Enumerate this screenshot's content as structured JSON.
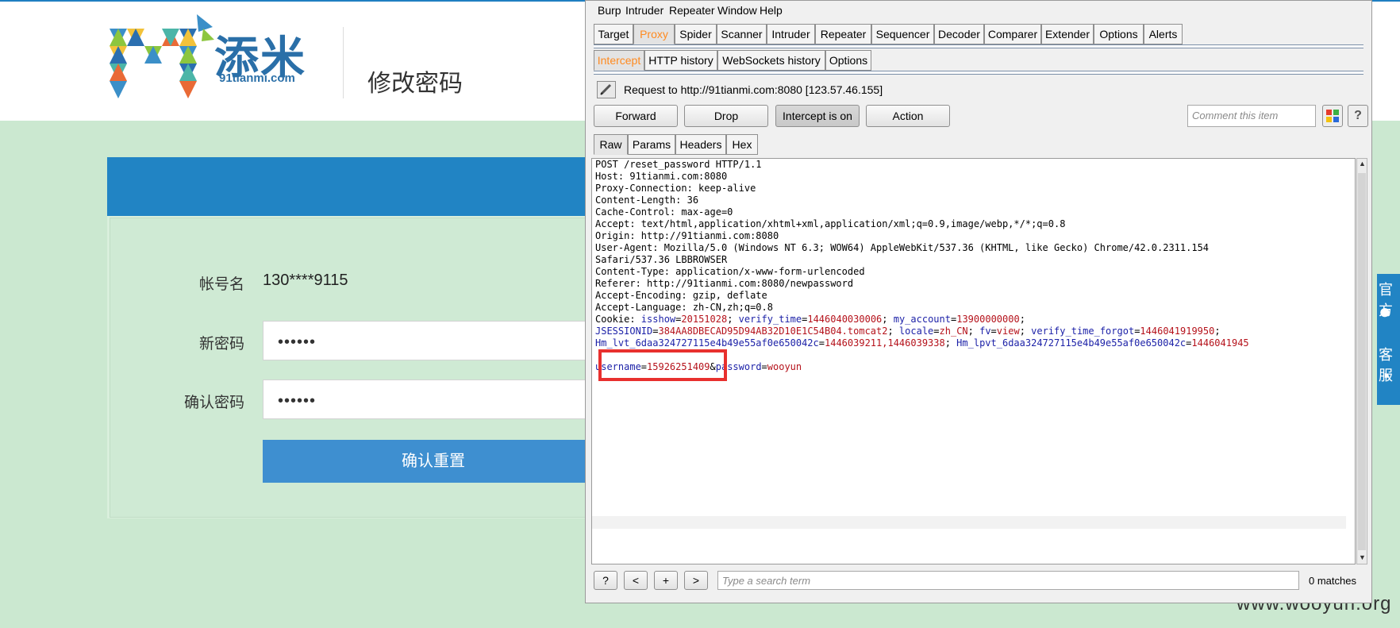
{
  "site": {
    "logo_cn": "添米",
    "logo_sub": "91tianmi.com",
    "page_title": "修改密码",
    "form": {
      "account_label": "帐号名",
      "account_value": "130****9115",
      "new_pwd_label": "新密码",
      "new_pwd_value": "••••••",
      "confirm_pwd_label": "确认密码",
      "confirm_pwd_value": "••••••",
      "submit_label": "确认重置"
    },
    "side_float": {
      "line1": "官方",
      "line2": "客服"
    },
    "watermark": "www.wooyun.org"
  },
  "burp": {
    "menu": [
      "Burp",
      "Intruder",
      "Repeater",
      "Window",
      "Help"
    ],
    "main_tabs": [
      "Target",
      "Proxy",
      "Spider",
      "Scanner",
      "Intruder",
      "Repeater",
      "Sequencer",
      "Decoder",
      "Comparer",
      "Extender",
      "Options",
      "Alerts"
    ],
    "main_active": "Proxy",
    "proxy_tabs": [
      "Intercept",
      "HTTP history",
      "WebSockets history",
      "Options"
    ],
    "proxy_active": "Intercept",
    "request_line": "Request to http://91tianmi.com:8080  [123.57.46.155]",
    "buttons": {
      "forward": "Forward",
      "drop": "Drop",
      "intercept": "Intercept is on",
      "action": "Action"
    },
    "comment_placeholder": "Comment this item",
    "help_label": "?",
    "view_tabs": [
      "Raw",
      "Params",
      "Headers",
      "Hex"
    ],
    "view_active": "Raw",
    "request_lines": [
      "POST /reset_password HTTP/1.1",
      "Host: 91tianmi.com:8080",
      "Proxy-Connection: keep-alive",
      "Content-Length: 36",
      "Cache-Control: max-age=0",
      "Accept: text/html,application/xhtml+xml,application/xml;q=0.9,image/webp,*/*;q=0.8",
      "Origin: http://91tianmi.com:8080",
      "User-Agent: Mozilla/5.0 (Windows NT 6.3; WOW64) AppleWebKit/537.36 (KHTML, like Gecko) Chrome/42.0.2311.154",
      "Safari/537.36 LBBROWSER",
      "Content-Type: application/x-www-form-urlencoded",
      "Referer: http://91tianmi.com:8080/newpassword",
      "Accept-Encoding: gzip, deflate",
      "Accept-Language: zh-CN,zh;q=0.8"
    ],
    "cookie_prefix": "Cookie: ",
    "cookie_lines": [
      [
        [
          "isshow",
          "20151028"
        ],
        [
          "verify_time",
          "1446040030006"
        ],
        [
          "my_account",
          "13900000000"
        ]
      ],
      [
        [
          "JSESSIONID",
          "384AA8DBECAD95D94AB32D10E1C54B04.tomcat2"
        ],
        [
          "locale",
          "zh_CN"
        ],
        [
          "fv",
          "view"
        ],
        [
          "verify_time_forgot",
          "1446041919950"
        ]
      ],
      [
        [
          "Hm_lvt_6daa324727115e4b49e55af0e650042c",
          "1446039211,1446039338"
        ],
        [
          "Hm_lpvt_6daa324727115e4b49e55af0e650042c",
          "1446041945"
        ]
      ]
    ],
    "body_params": [
      [
        "username",
        "15926251409"
      ],
      [
        "password",
        "wooyun"
      ]
    ],
    "search_buttons": [
      "?",
      "<",
      "+",
      ">"
    ],
    "search_placeholder": "Type a search term",
    "matches": "0 matches"
  },
  "colors": {
    "page_bg": "#cbe8d0",
    "brand_blue": "#2184c4",
    "submit_blue": "#3e8fd0",
    "burp_active_tab": "#ff8a1f",
    "param_name": "#1d22a8",
    "param_value": "#b5121b",
    "highlight": "#e8302e"
  }
}
